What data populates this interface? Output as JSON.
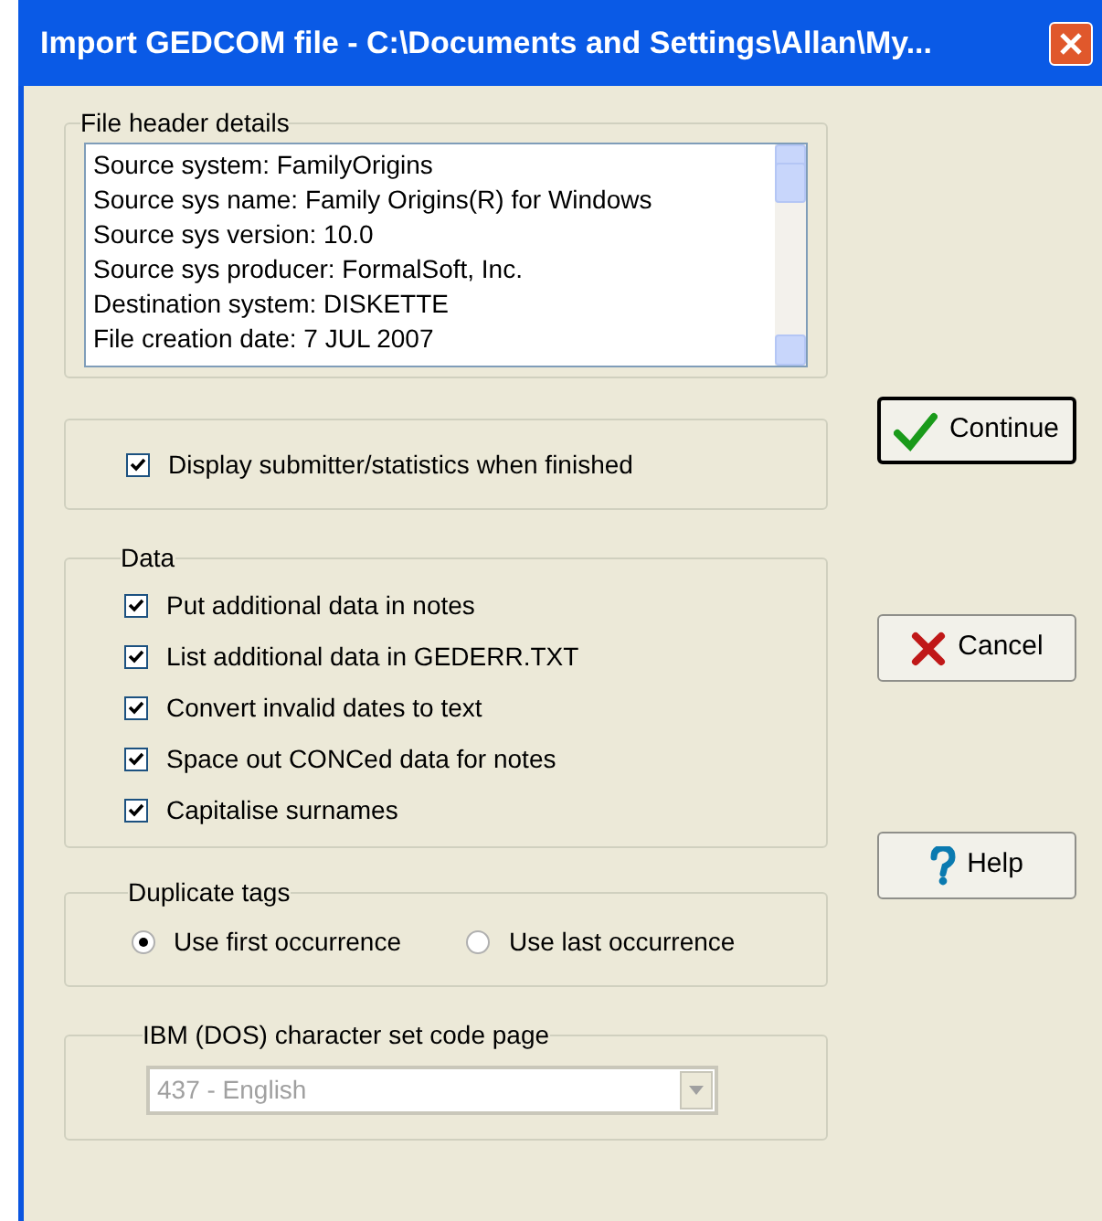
{
  "window": {
    "title": "Import GEDCOM file - C:\\Documents and Settings\\Allan\\My..."
  },
  "file_header": {
    "title": "File header details",
    "lines": [
      "Source system: FamilyOrigins",
      "Source sys name: Family Origins(R) for Windows",
      "Source sys version: 10.0",
      "Source sys producer: FormalSoft, Inc.",
      "Destination system: DISKETTE",
      "File creation date: 7 JUL 2007"
    ]
  },
  "display_option": {
    "label": "Display submitter/statistics when finished",
    "checked": true
  },
  "data": {
    "title": "Data",
    "options": [
      {
        "label": "Put additional data in notes",
        "checked": true
      },
      {
        "label": "List additional data in GEDERR.TXT",
        "checked": true
      },
      {
        "label": "Convert invalid dates to text",
        "checked": true
      },
      {
        "label": "Space out CONCed data for notes",
        "checked": true
      },
      {
        "label": "Capitalise surnames",
        "checked": true
      }
    ]
  },
  "duplicate_tags": {
    "title": "Duplicate tags",
    "options": [
      {
        "label": "Use first occurrence",
        "selected": true
      },
      {
        "label": "Use last occurrence",
        "selected": false
      }
    ]
  },
  "code_page": {
    "title": "IBM (DOS) character set code page",
    "value": "437 - English",
    "disabled": true
  },
  "buttons": [
    {
      "label": "Continue",
      "kind": "continue",
      "default": true
    },
    {
      "label": "Cancel",
      "kind": "cancel",
      "default": false
    },
    {
      "label": "Help",
      "kind": "help",
      "default": false
    }
  ]
}
